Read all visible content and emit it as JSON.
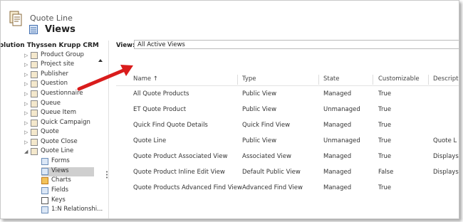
{
  "header": {
    "subtitle": "Quote Line",
    "title": "Views"
  },
  "sidebar": {
    "solution_title": "olution Thyssen Krupp CRM",
    "items": [
      {
        "label": "Product Group"
      },
      {
        "label": "Project site"
      },
      {
        "label": "Publisher"
      },
      {
        "label": "Question"
      },
      {
        "label": "Questionnaire"
      },
      {
        "label": "Queue"
      },
      {
        "label": "Queue Item"
      },
      {
        "label": "Quick Campaign"
      },
      {
        "label": "Quote"
      },
      {
        "label": "Quote Close"
      },
      {
        "label": "Quote Line"
      }
    ],
    "children": [
      {
        "label": "Forms"
      },
      {
        "label": "Views"
      },
      {
        "label": "Charts"
      },
      {
        "label": "Fields"
      },
      {
        "label": "Keys"
      },
      {
        "label": "1:N Relationshi..."
      }
    ]
  },
  "view": {
    "label": "View:",
    "selected": "All Active Views"
  },
  "grid": {
    "columns": [
      "Name ↑",
      "Type",
      "State",
      "Customizable",
      "Descripti"
    ],
    "rows": [
      [
        "All Quote Products",
        "Public View",
        "Managed",
        "True",
        ""
      ],
      [
        "ET Quote Product",
        "Public View",
        "Unmanaged",
        "True",
        ""
      ],
      [
        "Quick Find Quote Details",
        "Quick Find View",
        "Managed",
        "True",
        ""
      ],
      [
        "Quote Line",
        "Public View",
        "Unmanaged",
        "True",
        "Quote L"
      ],
      [
        "Quote Product Associated View",
        "Associated View",
        "Managed",
        "True",
        "Displays"
      ],
      [
        "Quote Product Inline Edit View",
        "Default Public View",
        "Managed",
        "False",
        "Displays"
      ],
      [
        "Quote Products Advanced Find View",
        "Advanced Find View",
        "Managed",
        "True",
        ""
      ]
    ]
  },
  "colors": {
    "arrow": "#d91c1c",
    "selected_item_bg": "#cfcfcf"
  }
}
